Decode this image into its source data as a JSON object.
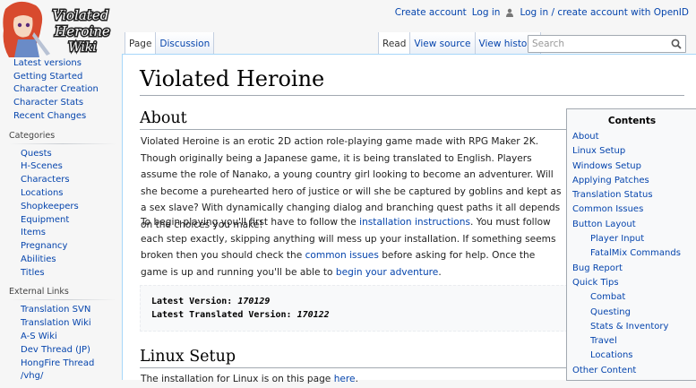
{
  "logo": {
    "text_lines": [
      "Violated",
      "Heroine",
      "Wiki"
    ]
  },
  "personal": {
    "create_account": "Create account",
    "login": "Log in",
    "openid": "Log in / create account with OpenID"
  },
  "tabs_left": [
    {
      "label": "Page"
    },
    {
      "label": "Discussion"
    }
  ],
  "tabs_right": [
    {
      "label": "Read"
    },
    {
      "label": "View source"
    },
    {
      "label": "View history"
    }
  ],
  "search": {
    "placeholder": "Search"
  },
  "sidebar": {
    "nav": [
      "Latest versions",
      "Getting Started",
      "Character Creation",
      "Character Stats",
      "Recent Changes"
    ],
    "categories_title": "Categories",
    "categories": [
      "Quests",
      "H-Scenes",
      "Characters",
      "Locations",
      "Shopkeepers",
      "Equipment",
      "Items",
      "Pregnancy",
      "Abilities",
      "Titles"
    ],
    "external_title": "External Links",
    "external": [
      "Translation SVN",
      "Translation Wiki",
      "A-S Wiki",
      "Dev Thread (JP)",
      "HongFire Thread",
      "/vhg/"
    ]
  },
  "page": {
    "title": "Violated Heroine",
    "about_heading": "About",
    "about_p1": "Violated Heroine is an erotic 2D action role-playing game made with RPG Maker 2K. Though originally being a Japanese game, it is being translated to English. Players assume the role of Nanako, a young country girl looking to become an adventurer. Will she become a purehearted hero of justice or will she be captured by goblins and kept as a sex slave? With dynamically changing dialog and branching quest paths it all depends on the choices you make!",
    "about_p2": {
      "t1": "To begin playing you'll first have to follow the ",
      "link1": "installation instructions",
      "t2": ". You must follow each step exactly, skipping anything will mess up your installation. If something seems broken then you should check the ",
      "link2": "common issues",
      "t3": " before asking for help. Once the game is up and running you'll be able to ",
      "link3": "begin your adventure",
      "t4": "."
    },
    "latest_label": "Latest Version: ",
    "latest_value": "170129",
    "translated_label": "Latest Translated Version: ",
    "translated_value": "170122",
    "linux_heading": "Linux Setup",
    "linux_p": {
      "t1": "The installation for Linux is on this page ",
      "link": "here",
      "t2": "."
    }
  },
  "toc": {
    "title": "Contents",
    "items": [
      {
        "label": "About",
        "level": 1
      },
      {
        "label": "Linux Setup",
        "level": 1
      },
      {
        "label": "Windows Setup",
        "level": 1
      },
      {
        "label": "Applying Patches",
        "level": 1
      },
      {
        "label": "Translation Status",
        "level": 1
      },
      {
        "label": "Common Issues",
        "level": 1
      },
      {
        "label": "Button Layout",
        "level": 1
      },
      {
        "label": "Player Input",
        "level": 2
      },
      {
        "label": "FatalMix Commands",
        "level": 2
      },
      {
        "label": "Bug Report",
        "level": 1
      },
      {
        "label": "Quick Tips",
        "level": 1
      },
      {
        "label": "Combat",
        "level": 2
      },
      {
        "label": "Questing",
        "level": 2
      },
      {
        "label": "Stats & Inventory",
        "level": 2
      },
      {
        "label": "Travel",
        "level": 2
      },
      {
        "label": "Locations",
        "level": 2
      },
      {
        "label": "Other Content",
        "level": 1
      }
    ]
  }
}
